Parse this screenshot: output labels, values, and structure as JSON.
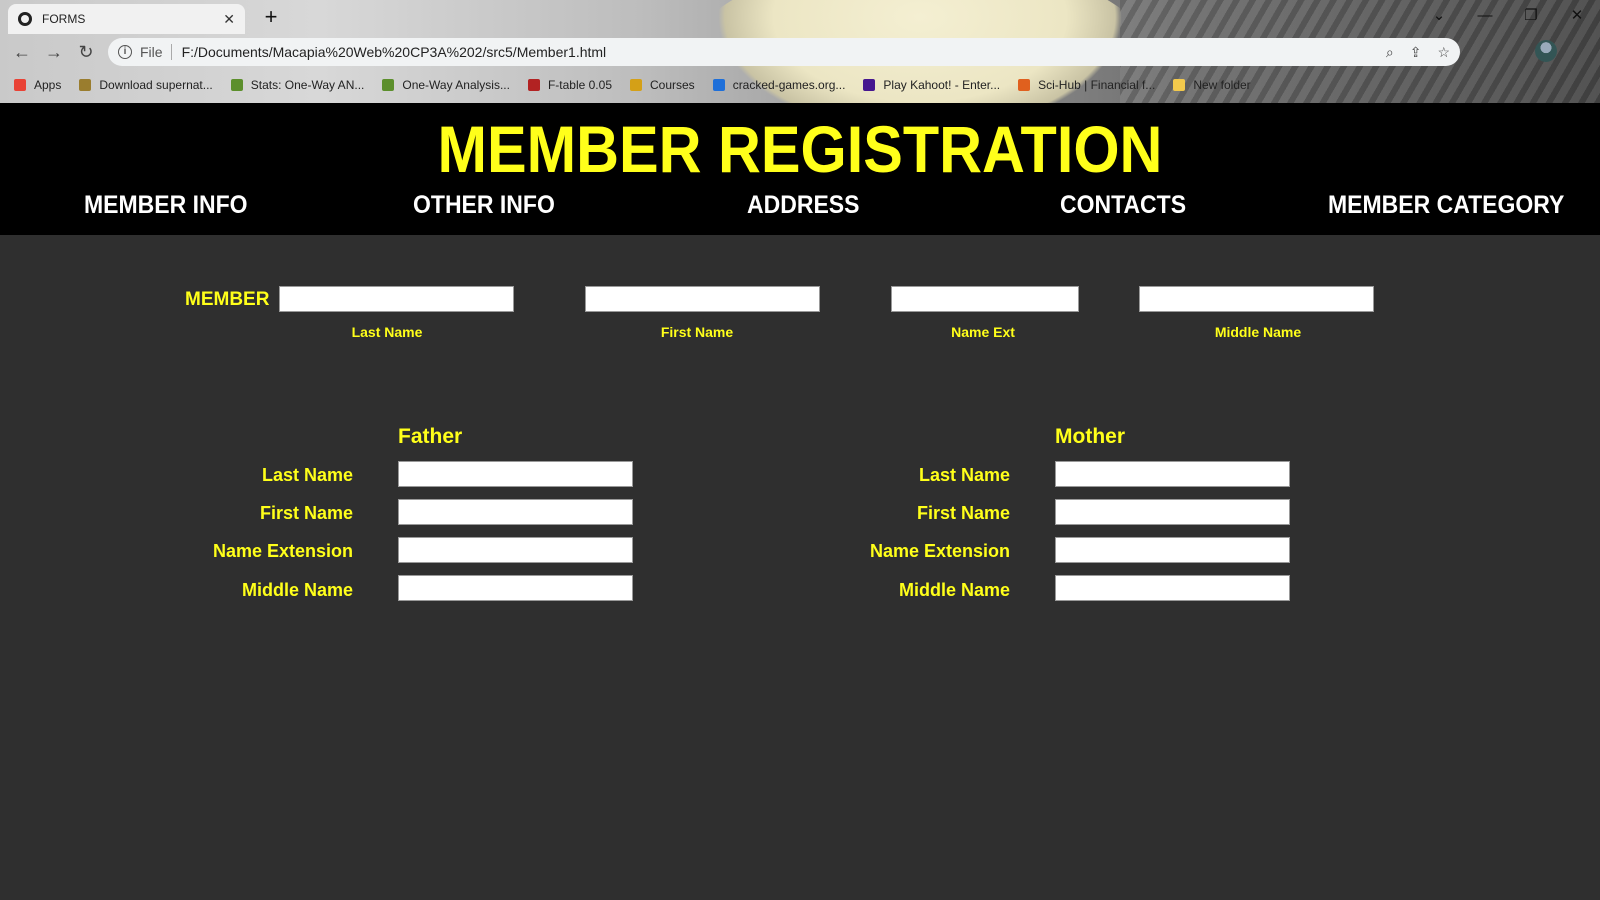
{
  "browser": {
    "tab_title": "FORMS",
    "address": {
      "scheme_label": "File",
      "url": "F:/Documents/Macapia%20Web%20CP3A%202/src5/Member1.html"
    },
    "bookmarks": [
      {
        "label": "Apps",
        "icon": "apps-grid-icon",
        "color": "#e94235"
      },
      {
        "label": "Download supernat...",
        "icon": "site-favicon-icon",
        "color": "#9a7d2e"
      },
      {
        "label": "Stats: One-Way AN...",
        "icon": "leaf-icon",
        "color": "#5c8f2c"
      },
      {
        "label": "One-Way Analysis...",
        "icon": "leaf-icon",
        "color": "#5c8f2c"
      },
      {
        "label": "F-table 0.05",
        "icon": "crest-icon",
        "color": "#b22222"
      },
      {
        "label": "Courses",
        "icon": "course-icon",
        "color": "#d4a017"
      },
      {
        "label": "cracked-games.org...",
        "icon": "download-icon",
        "color": "#1e6fd9"
      },
      {
        "label": "Play Kahoot! - Enter...",
        "icon": "kahoot-icon",
        "color": "#46178f"
      },
      {
        "label": "Sci-Hub | Financial f...",
        "icon": "eye-icon",
        "color": "#e0601e"
      },
      {
        "label": "New folder",
        "icon": "folder-icon",
        "color": "#f2c94c"
      }
    ]
  },
  "page": {
    "title": "MEMBER REGISTRATION",
    "accent_color": "#ffff1a",
    "nav": [
      "MEMBER INFO",
      "OTHER INFO",
      "ADDRESS",
      "CONTACTS",
      "MEMBER CATEGORY"
    ],
    "member": {
      "label": "MEMBER",
      "fields": [
        {
          "caption": "Last Name",
          "value": ""
        },
        {
          "caption": "First Name",
          "value": ""
        },
        {
          "caption": "Name Ext",
          "value": ""
        },
        {
          "caption": "Middle Name",
          "value": ""
        }
      ]
    },
    "father": {
      "heading": "Father",
      "rows": [
        {
          "label": "Last Name",
          "value": ""
        },
        {
          "label": "First Name",
          "value": ""
        },
        {
          "label": "Name Extension",
          "value": ""
        },
        {
          "label": "Middle Name",
          "value": ""
        }
      ]
    },
    "mother": {
      "heading": "Mother",
      "rows": [
        {
          "label": "Last Name",
          "value": ""
        },
        {
          "label": "First Name",
          "value": ""
        },
        {
          "label": "Name Extension",
          "value": ""
        },
        {
          "label": "Middle Name",
          "value": ""
        }
      ]
    }
  }
}
